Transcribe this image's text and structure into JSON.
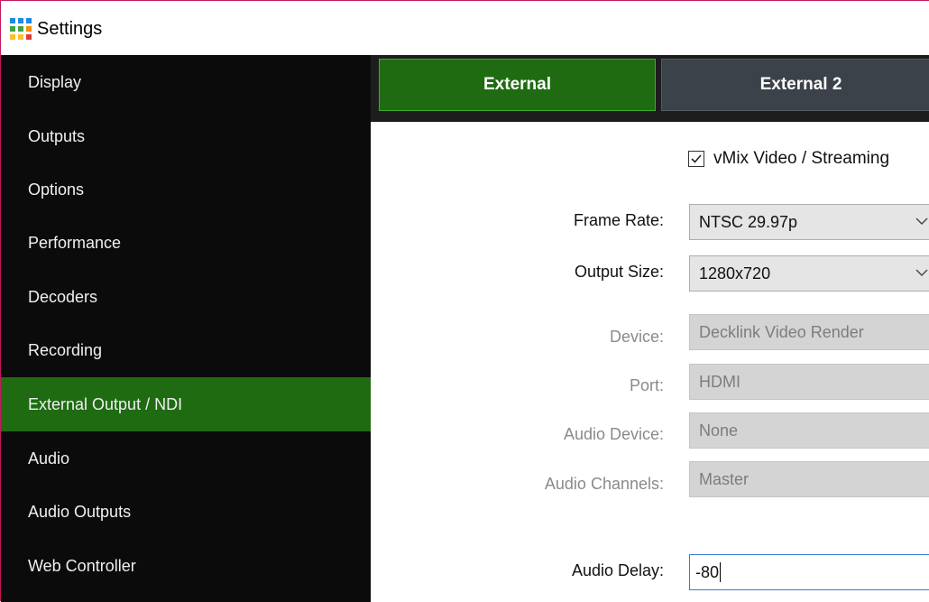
{
  "window": {
    "title": "Settings",
    "icon": "vmix-grid-icon"
  },
  "sidebar": {
    "items": [
      {
        "label": "Display",
        "active": false
      },
      {
        "label": "Outputs",
        "active": false
      },
      {
        "label": "Options",
        "active": false
      },
      {
        "label": "Performance",
        "active": false
      },
      {
        "label": "Decoders",
        "active": false
      },
      {
        "label": "Recording",
        "active": false
      },
      {
        "label": "External Output / NDI",
        "active": true
      },
      {
        "label": "Audio",
        "active": false
      },
      {
        "label": "Audio Outputs",
        "active": false
      },
      {
        "label": "Web Controller",
        "active": false
      }
    ]
  },
  "tabs": [
    {
      "label": "External",
      "active": true
    },
    {
      "label": "External 2",
      "active": false
    }
  ],
  "form": {
    "vmix_checkbox": {
      "label": "vMix Video / Streaming",
      "checked": true
    },
    "frame_rate": {
      "label": "Frame Rate:",
      "value": "NTSC 29.97p"
    },
    "output_size": {
      "label": "Output Size:",
      "value": "1280x720"
    },
    "device": {
      "label": "Device:",
      "value": "Decklink Video Render"
    },
    "port": {
      "label": "Port:",
      "value": "HDMI"
    },
    "audio_device": {
      "label": "Audio Device:",
      "value": "None"
    },
    "audio_channels": {
      "label": "Audio Channels:",
      "value": "Master"
    },
    "audio_delay": {
      "label": "Audio Delay:",
      "value": "-80"
    }
  },
  "colors": {
    "accent_green": "#1f6b12",
    "sidebar_bg": "#0b0b0b",
    "tab_inactive": "#3c4249"
  }
}
